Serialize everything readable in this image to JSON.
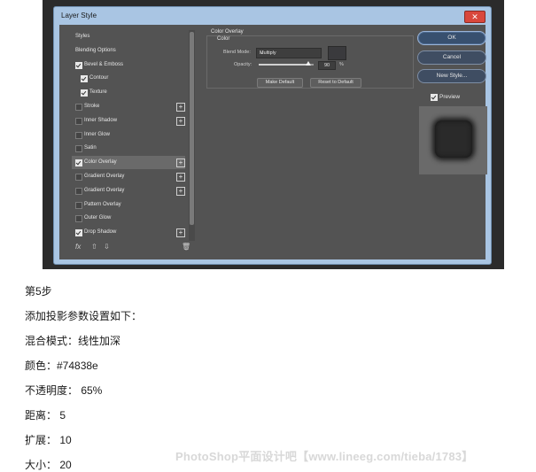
{
  "dialog": {
    "title": "Layer Style",
    "close_symbol": "✕",
    "styles_list": [
      {
        "label": "Styles",
        "checkbox": false,
        "checked": false,
        "plus": false,
        "indent": false,
        "selected": false
      },
      {
        "label": "Blending Options",
        "checkbox": false,
        "checked": false,
        "plus": false,
        "indent": false,
        "selected": false
      },
      {
        "label": "Bevel & Emboss",
        "checkbox": true,
        "checked": true,
        "plus": false,
        "indent": false,
        "selected": false
      },
      {
        "label": "Contour",
        "checkbox": true,
        "checked": true,
        "plus": false,
        "indent": true,
        "selected": false
      },
      {
        "label": "Texture",
        "checkbox": true,
        "checked": true,
        "plus": false,
        "indent": true,
        "selected": false
      },
      {
        "label": "Stroke",
        "checkbox": true,
        "checked": false,
        "plus": true,
        "indent": false,
        "selected": false
      },
      {
        "label": "Inner Shadow",
        "checkbox": true,
        "checked": false,
        "plus": true,
        "indent": false,
        "selected": false
      },
      {
        "label": "Inner Glow",
        "checkbox": true,
        "checked": false,
        "plus": false,
        "indent": false,
        "selected": false
      },
      {
        "label": "Satin",
        "checkbox": true,
        "checked": false,
        "plus": false,
        "indent": false,
        "selected": false
      },
      {
        "label": "Color Overlay",
        "checkbox": true,
        "checked": true,
        "plus": true,
        "indent": false,
        "selected": true
      },
      {
        "label": "Gradient Overlay",
        "checkbox": true,
        "checked": false,
        "plus": true,
        "indent": false,
        "selected": false
      },
      {
        "label": "Gradient Overlay",
        "checkbox": true,
        "checked": false,
        "plus": true,
        "indent": false,
        "selected": false
      },
      {
        "label": "Pattern Overlay",
        "checkbox": true,
        "checked": false,
        "plus": false,
        "indent": false,
        "selected": false
      },
      {
        "label": "Outer Glow",
        "checkbox": true,
        "checked": false,
        "plus": false,
        "indent": false,
        "selected": false
      },
      {
        "label": "Drop Shadow",
        "checkbox": true,
        "checked": true,
        "plus": true,
        "indent": false,
        "selected": false
      }
    ],
    "list_footer": {
      "fx": "fx",
      "up": "⇧",
      "down": "⇩",
      "trash": "🗑"
    },
    "panel": {
      "group_title": "Color Overlay",
      "sub_title": "Color",
      "blend_mode_label": "Blend Mode:",
      "blend_mode_value": "Multiply",
      "overlay_color": "#3a3a3d",
      "opacity_label": "Opacity:",
      "opacity_value": "90",
      "opacity_fraction": 0.9,
      "opacity_unit": "%",
      "make_default": "Make Default",
      "reset_default": "Reset to Default"
    },
    "buttons": {
      "ok": "OK",
      "cancel": "Cancel",
      "new_style": "New Style..."
    },
    "preview_label": "Preview"
  },
  "article": {
    "step": "第5步",
    "intro": "添加投影参数设置如下：",
    "blend": "混合模式：线性加深",
    "color": "颜色：#74838e",
    "opacity": "不透明度： 65%",
    "distance": "距离： 5",
    "spread": "扩展： 10",
    "size": "大小： 20"
  },
  "watermark": "PhotoShop平面设计吧【www.lineeg.com/tieba/1783】"
}
